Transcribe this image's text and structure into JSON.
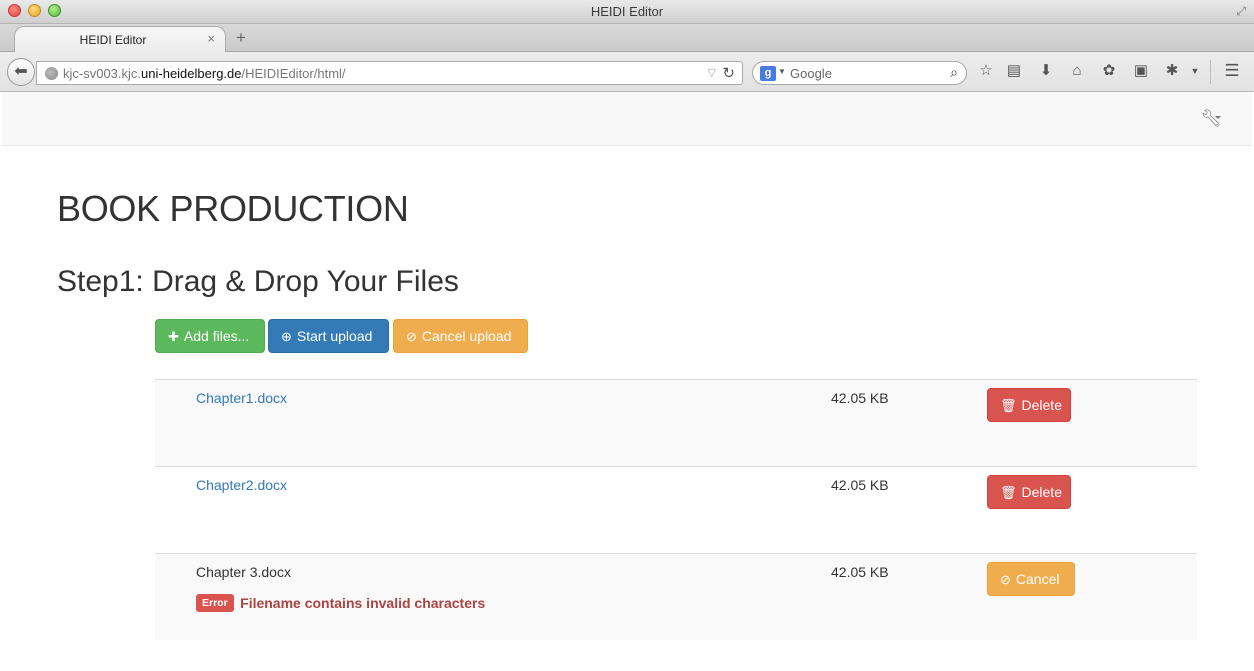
{
  "window": {
    "title": "HEIDI Editor"
  },
  "browser": {
    "tab_label": "HEIDI Editor",
    "tab_close": "×",
    "new_tab": "+",
    "url_prefix": "kjc-sv003.kjc.",
    "url_host": "uni-heidelberg.de",
    "url_path": "/HEIDIEditor/html/",
    "search_engine_letter": "g",
    "search_placeholder": "Google"
  },
  "page": {
    "title": "BOOK PRODUCTION",
    "step_heading": "Step1: Drag & Drop Your Files",
    "toolbar": {
      "add_files_label": "Add files...",
      "start_upload_label": "Start upload",
      "cancel_upload_label": "Cancel upload"
    },
    "files": [
      {
        "name": "Chapter1.docx",
        "size": "42.05 KB",
        "action": "Delete"
      },
      {
        "name": "Chapter2.docx",
        "size": "42.05 KB",
        "action": "Delete"
      },
      {
        "name": "Chapter 3.docx",
        "size": "42.05 KB",
        "action": "Cancel",
        "error_label": "Error",
        "error_message": "Filename contains invalid characters"
      }
    ]
  },
  "colors": {
    "success": "#5cb85c",
    "primary": "#337ab7",
    "warning": "#f0ad4e",
    "danger": "#d9534f",
    "error_text": "#a94442"
  }
}
